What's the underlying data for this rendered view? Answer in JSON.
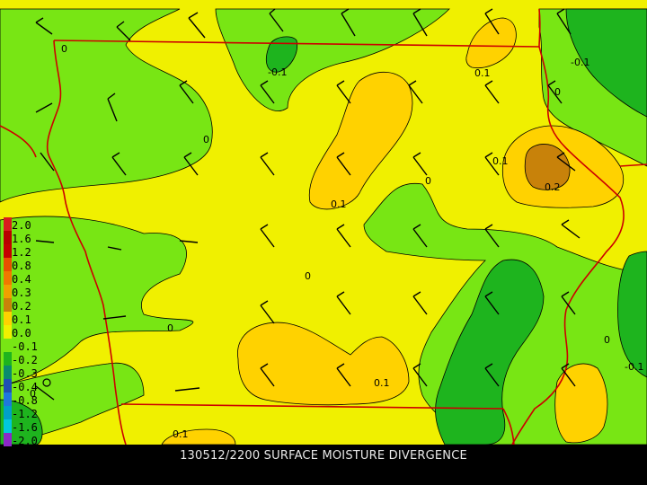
{
  "caption": "130512/2200 SURFACE MOISTURE DIVERGENCE",
  "colorbar": {
    "entries": [
      {
        "label": "2.0",
        "color": "#d81e1e"
      },
      {
        "label": "1.6",
        "color": "#b80000"
      },
      {
        "label": "1.2",
        "color": "#c40000"
      },
      {
        "label": "0.8",
        "color": "#e85000"
      },
      {
        "label": "0.4",
        "color": "#f07800"
      },
      {
        "label": "0.3",
        "color": "#f0a000"
      },
      {
        "label": "0.2",
        "color": "#c8820a"
      },
      {
        "label": "0.1",
        "color": "#ffd200"
      },
      {
        "label": "0.0",
        "color": "#f0f000"
      },
      {
        "label": "-0.1",
        "color": "#78e614"
      },
      {
        "label": "-0.2",
        "color": "#1eb41e"
      },
      {
        "label": "-0.3",
        "color": "#0a8c6e"
      },
      {
        "label": "-0.4",
        "color": "#1e50b4"
      },
      {
        "label": "-0.8",
        "color": "#1e78dc"
      },
      {
        "label": "-1.2",
        "color": "#00a0c8"
      },
      {
        "label": "-1.6",
        "color": "#00c8dc"
      },
      {
        "label": "-2.0",
        "color": "#8c28c8"
      }
    ]
  },
  "contour_labels": [
    "0",
    "-0.1",
    "0",
    "0.1",
    "-0.1",
    "0",
    "0",
    "0.1",
    "0.1",
    "0",
    "0.2",
    "0",
    "0",
    "0.1",
    "0",
    "-0.1",
    "0.1"
  ],
  "colors": {
    "yellow": "#f0f000",
    "orange": "#ffd200",
    "light_green": "#78e614",
    "dark_green": "#1eb41e",
    "brown": "#c8820a",
    "border": "#cc0000"
  }
}
